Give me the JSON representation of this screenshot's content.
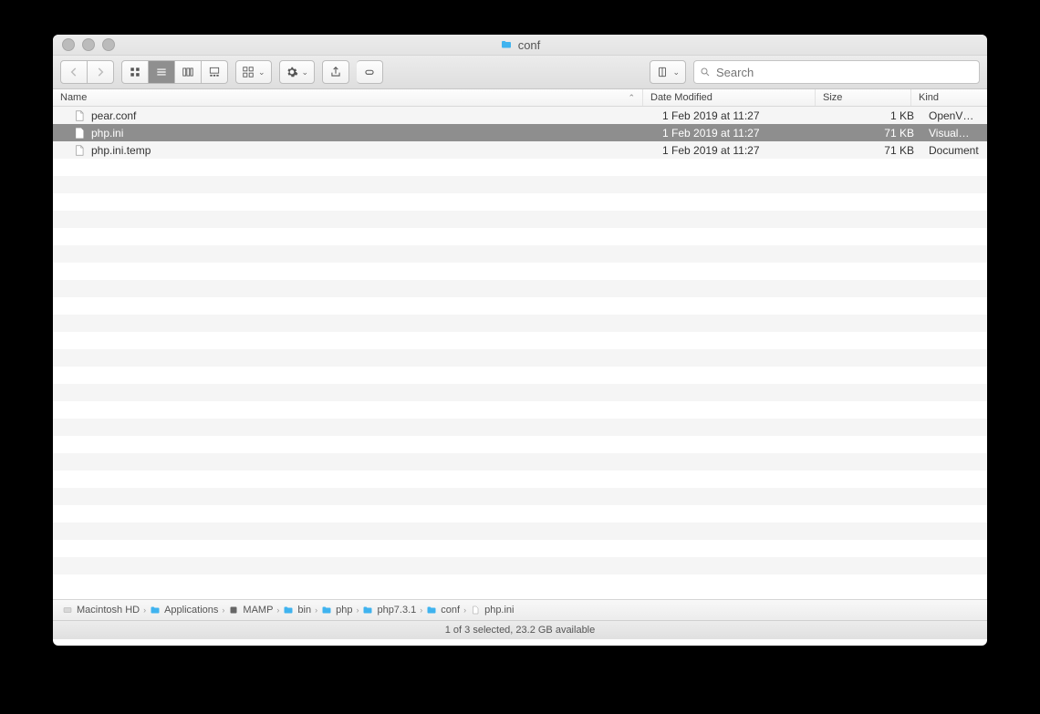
{
  "window": {
    "title": "conf"
  },
  "toolbar": {
    "search_placeholder": "Search"
  },
  "columns": {
    "name": "Name",
    "date": "Date Modified",
    "size": "Size",
    "kind": "Kind"
  },
  "files": [
    {
      "name": "pear.conf",
      "date": "1 Feb 2019 at 11:27",
      "size": "1 KB",
      "kind": "OpenV…uration",
      "icon": "conf",
      "selected": false
    },
    {
      "name": "php.ini",
      "date": "1 Feb 2019 at 11:27",
      "size": "71 KB",
      "kind": "Visual…ocument",
      "icon": "ini",
      "selected": true
    },
    {
      "name": "php.ini.temp",
      "date": "1 Feb 2019 at 11:27",
      "size": "71 KB",
      "kind": "Document",
      "icon": "doc",
      "selected": false
    }
  ],
  "path": [
    {
      "label": "Macintosh HD",
      "icon": "drive"
    },
    {
      "label": "Applications",
      "icon": "folder"
    },
    {
      "label": "MAMP",
      "icon": "app"
    },
    {
      "label": "bin",
      "icon": "folder"
    },
    {
      "label": "php",
      "icon": "folder"
    },
    {
      "label": "php7.3.1",
      "icon": "folder"
    },
    {
      "label": "conf",
      "icon": "folder"
    },
    {
      "label": "php.ini",
      "icon": "file"
    }
  ],
  "status": "1 of 3 selected, 23.2 GB available"
}
